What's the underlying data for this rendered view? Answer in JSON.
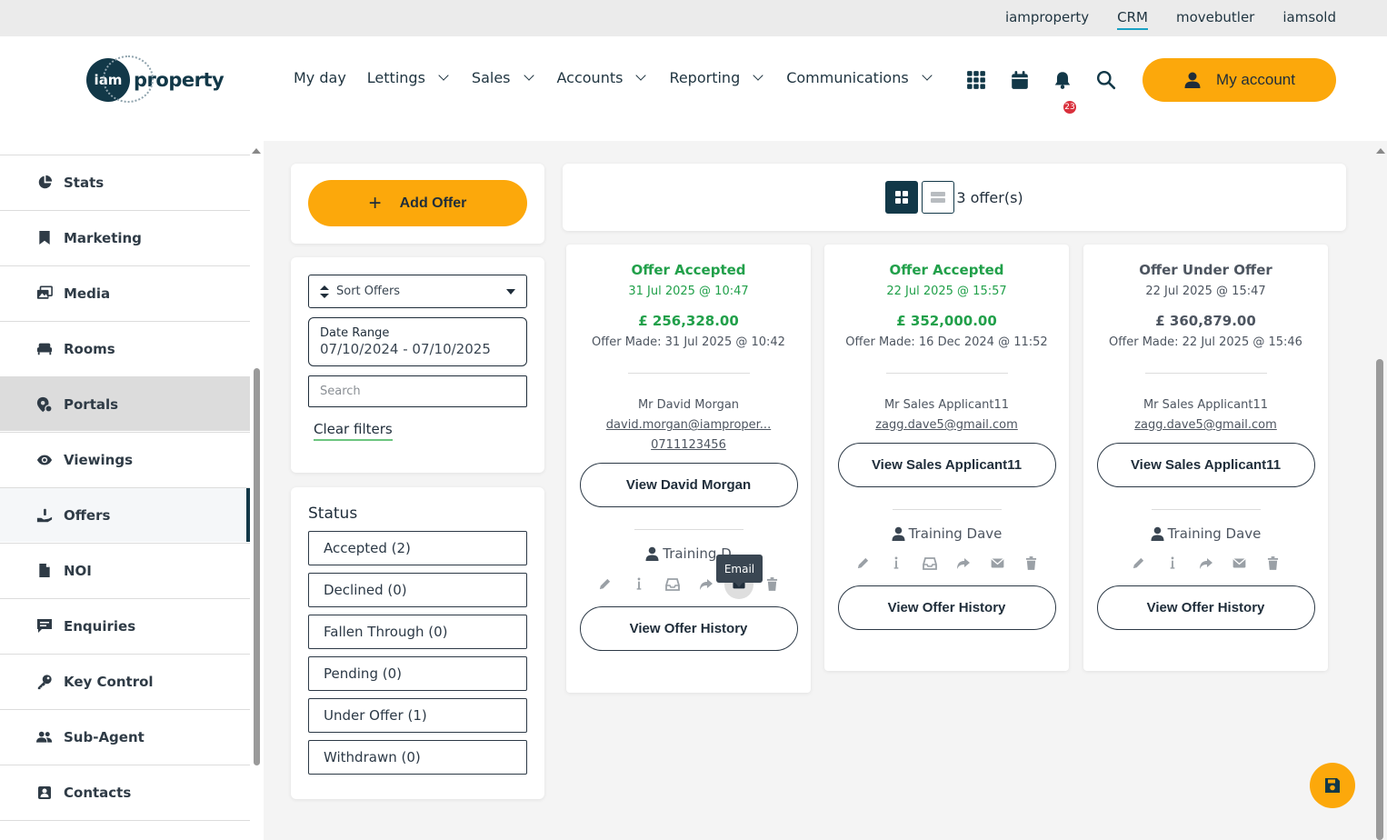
{
  "top_links": [
    {
      "label": "iamproperty",
      "active": false
    },
    {
      "label": "CRM",
      "active": true
    },
    {
      "label": "movebutler",
      "active": false
    },
    {
      "label": "iamsold",
      "active": false
    }
  ],
  "logo": {
    "mark": "iam",
    "word": "property"
  },
  "nav": [
    {
      "label": "My day",
      "dropdown": false
    },
    {
      "label": "Lettings",
      "dropdown": true
    },
    {
      "label": "Sales",
      "dropdown": true
    },
    {
      "label": "Accounts",
      "dropdown": true
    },
    {
      "label": "Reporting",
      "dropdown": true
    },
    {
      "label": "Communications",
      "dropdown": true
    }
  ],
  "header_icons": [
    "apps-grid-icon",
    "calendar-icon",
    "bell-icon",
    "search-icon"
  ],
  "notification_count": "23",
  "account_button": "My account",
  "sidebar": [
    {
      "label": "Stats",
      "icon": "pie-chart-icon",
      "state": ""
    },
    {
      "label": "Marketing",
      "icon": "bookmark-icon",
      "state": ""
    },
    {
      "label": "Media",
      "icon": "photos-icon",
      "state": ""
    },
    {
      "label": "Rooms",
      "icon": "couch-icon",
      "state": ""
    },
    {
      "label": "Portals",
      "icon": "portal-icon",
      "state": "hover"
    },
    {
      "label": "Viewings",
      "icon": "eye-icon",
      "state": ""
    },
    {
      "label": "Offers",
      "icon": "hand-money-icon",
      "state": "active"
    },
    {
      "label": "NOI",
      "icon": "file-icon",
      "state": ""
    },
    {
      "label": "Enquiries",
      "icon": "comment-icon",
      "state": ""
    },
    {
      "label": "Key Control",
      "icon": "key-icon",
      "state": ""
    },
    {
      "label": "Sub-Agent",
      "icon": "users-icon",
      "state": ""
    },
    {
      "label": "Contacts",
      "icon": "contact-card-icon",
      "state": ""
    }
  ],
  "filters": {
    "add_offer": "Add Offer",
    "sort_label": "Sort Offers",
    "date_range_label": "Date Range",
    "date_range_value": "07/10/2024 - 07/10/2025",
    "search_placeholder": "Search",
    "clear_filters": "Clear filters"
  },
  "status": {
    "title": "Status",
    "options": [
      "Accepted (2)",
      "Declined (0)",
      "Fallen Through (0)",
      "Pending (0)",
      "Under Offer (1)",
      "Withdrawn (0)"
    ]
  },
  "offer_count": "3 offer(s)",
  "offers": [
    {
      "status": "Offer Accepted",
      "status_color": "green",
      "date": "31 Jul 2025 @ 10:47",
      "amount": "£ 256,328.00",
      "made": "Offer Made: 31 Jul 2025 @ 10:42",
      "name": "Mr David Morgan",
      "email": "david.morgan@iamproper...",
      "phone": "0711123456",
      "view_button": "View David Morgan",
      "agent": "Training D",
      "history_button": "View Offer History"
    },
    {
      "status": "Offer Accepted",
      "status_color": "green",
      "date": "22 Jul 2025 @ 15:57",
      "amount": "£ 352,000.00",
      "made": "Offer Made: 16 Dec 2024 @ 11:52",
      "name": "Mr Sales Applicant11",
      "email": "zagg.dave5@gmail.com",
      "phone": "",
      "view_button": "View Sales Applicant11",
      "agent": "Training Dave",
      "history_button": "View Offer History"
    },
    {
      "status": "Offer Under Offer",
      "status_color": "grey",
      "date": "22 Jul 2025 @ 15:47",
      "amount": "£ 360,879.00",
      "made": "Offer Made: 22 Jul 2025 @ 15:46",
      "name": "Mr Sales Applicant11",
      "email": "zagg.dave5@gmail.com",
      "phone": "",
      "view_button": "View Sales Applicant11",
      "agent": "Training Dave",
      "history_button": "View Offer History"
    }
  ],
  "tooltip": "Email",
  "colors": {
    "accent": "#fca80b",
    "brand": "#123848",
    "success": "#21a04a"
  }
}
